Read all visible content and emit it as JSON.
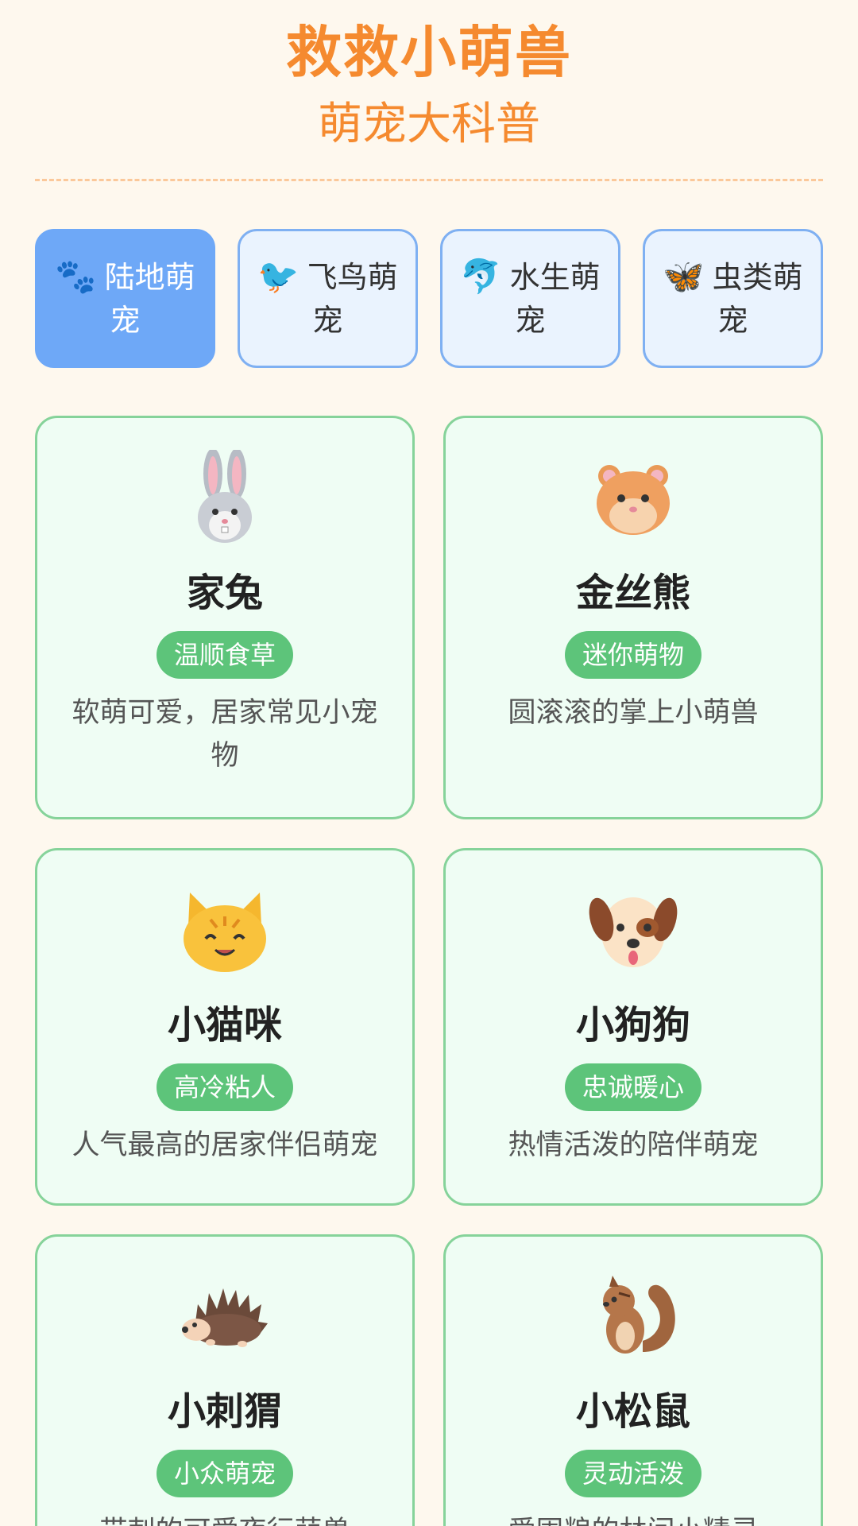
{
  "header": {
    "title": "救救小萌兽",
    "subtitle": "萌宠大科普"
  },
  "tabs": [
    {
      "icon": "🐾",
      "icon_name": "paw-icon",
      "label": "陆地萌宠",
      "active": true
    },
    {
      "icon": "🐦",
      "icon_name": "bird-icon",
      "label": "飞鸟萌宠",
      "active": false
    },
    {
      "icon": "🐬",
      "icon_name": "dolphin-icon",
      "label": "水生萌宠",
      "active": false
    },
    {
      "icon": "🦋",
      "icon_name": "butterfly-icon",
      "label": "虫类萌宠",
      "active": false
    }
  ],
  "cards": [
    {
      "icon_name": "rabbit-icon",
      "name": "家兔",
      "tag": "温顺食草",
      "desc": "软萌可爱，居家常见小宠物"
    },
    {
      "icon_name": "hamster-icon",
      "name": "金丝熊",
      "tag": "迷你萌物",
      "desc": "圆滚滚的掌上小萌兽"
    },
    {
      "icon_name": "cat-icon",
      "name": "小猫咪",
      "tag": "高冷粘人",
      "desc": "人气最高的居家伴侣萌宠"
    },
    {
      "icon_name": "dog-icon",
      "name": "小狗狗",
      "tag": "忠诚暖心",
      "desc": "热情活泼的陪伴萌宠"
    },
    {
      "icon_name": "hedgehog-icon",
      "name": "小刺猬",
      "tag": "小众萌宠",
      "desc": "带刺的可爱夜行萌兽"
    },
    {
      "icon_name": "squirrel-icon",
      "name": "小松鼠",
      "tag": "灵动活泼",
      "desc": "爱囤粮的林间小精灵"
    }
  ],
  "colors": {
    "accent": "#F58A2F",
    "tab_active": "#6EA8F7",
    "tab_border": "#7FB0F2",
    "card_border": "#86D39A",
    "tag_bg": "#5DC47A",
    "background": "#FEF8EE"
  }
}
